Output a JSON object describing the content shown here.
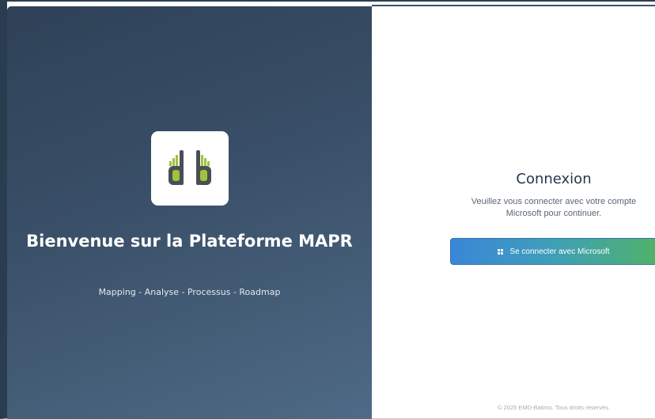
{
  "welcome": {
    "logo_name": "emd-batimo-logo",
    "title": "Bienvenue sur la Plateforme MAPR",
    "tagline": "Mapping - Analyse - Processus - Roadmap"
  },
  "login": {
    "title": "Connexion",
    "description": "Veuillez vous connecter avec votre compte Microsoft pour continuer.",
    "button_label": "Se connecter avec Microsoft",
    "button_icon": "windows-icon"
  },
  "footer": {
    "copyright": "© 2025 EMD-Batimo. Tous droits réservés."
  },
  "colors": {
    "panel_dark": "#2e4157",
    "panel_light": "#4e6a86",
    "title_text": "#24374c",
    "button_blue": "#3a86d8",
    "button_green": "#4fb26a",
    "logo_green": "#9dc43c",
    "logo_dark": "#4a4f55"
  }
}
